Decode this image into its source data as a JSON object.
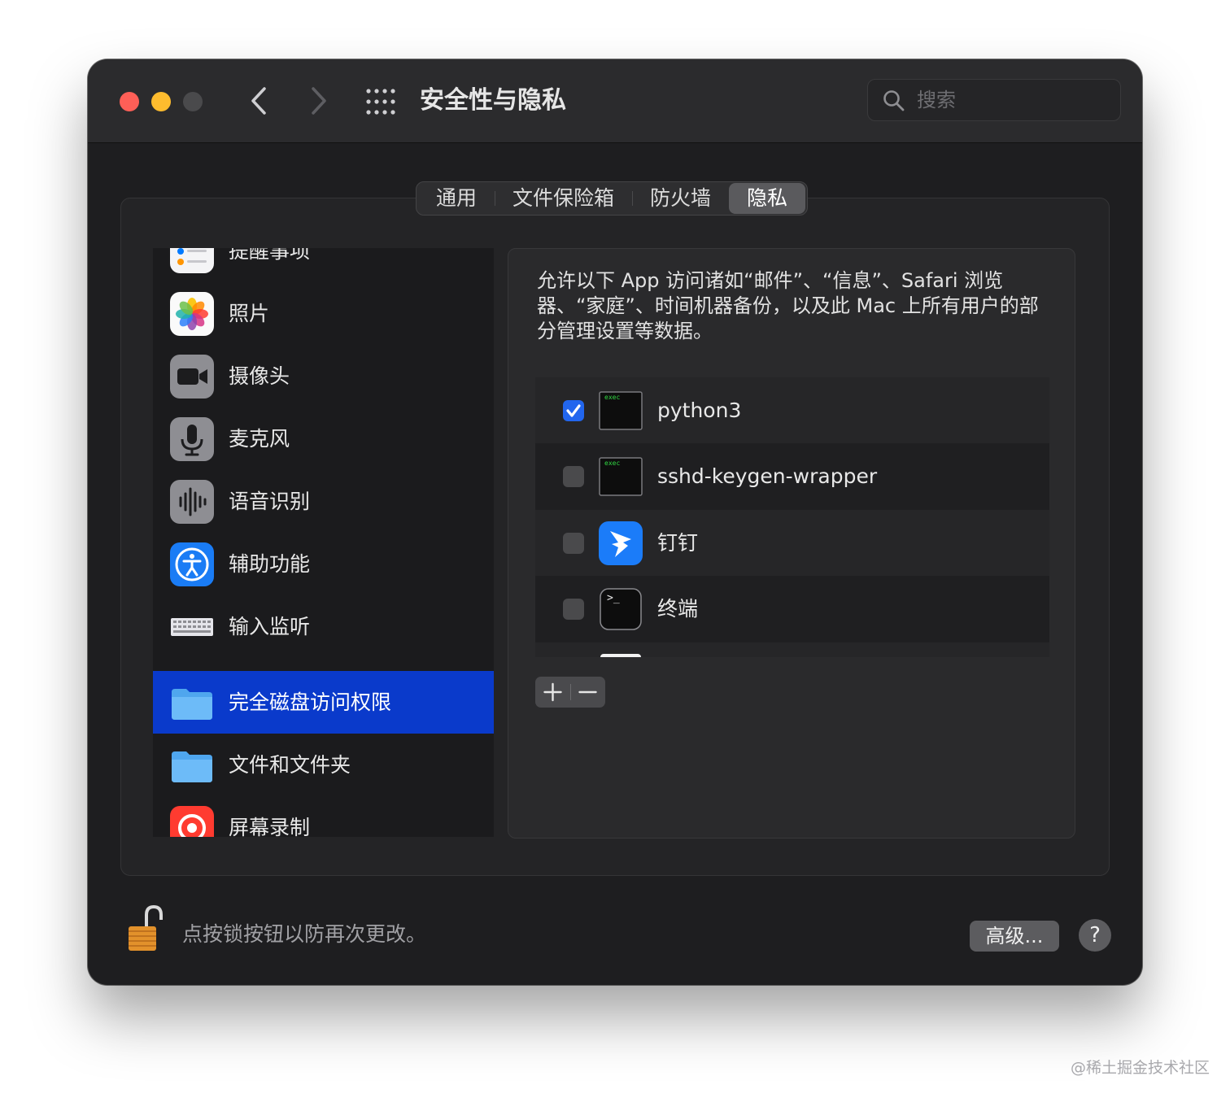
{
  "window": {
    "title": "安全性与隐私",
    "search_placeholder": "搜索"
  },
  "tabs": [
    {
      "label": "通用",
      "active": false
    },
    {
      "label": "文件保险箱",
      "active": false
    },
    {
      "label": "防火墙",
      "active": false
    },
    {
      "label": "隐私",
      "active": true
    }
  ],
  "sidebar": {
    "items": [
      {
        "label": "提醒事项",
        "icon": "reminders-icon"
      },
      {
        "label": "照片",
        "icon": "photos-icon"
      },
      {
        "label": "摄像头",
        "icon": "camera-icon"
      },
      {
        "label": "麦克风",
        "icon": "microphone-icon"
      },
      {
        "label": "语音识别",
        "icon": "speech-recognition-icon"
      },
      {
        "label": "辅助功能",
        "icon": "accessibility-icon"
      },
      {
        "label": "输入监听",
        "icon": "keyboard-icon"
      },
      {
        "label": "完全磁盘访问权限",
        "icon": "folder-icon",
        "selected": true
      },
      {
        "label": "文件和文件夹",
        "icon": "folder-icon"
      },
      {
        "label": "屏幕录制",
        "icon": "screen-recording-icon"
      }
    ]
  },
  "panel": {
    "description": "允许以下 App 访问诸如“邮件”、“信息”、Safari 浏览器、“家庭”、时间机器备份，以及此 Mac 上所有用户的部分管理设置等数据。",
    "apps": [
      {
        "name": "python3",
        "checked": true,
        "icon": "exec-icon",
        "icon_text": "exec"
      },
      {
        "name": "sshd-keygen-wrapper",
        "checked": false,
        "icon": "exec-icon",
        "icon_text": "exec"
      },
      {
        "name": "钉钉",
        "checked": false,
        "icon": "dingtalk-icon"
      },
      {
        "name": "终端",
        "checked": false,
        "icon": "terminal-icon",
        "icon_text": ">_"
      }
    ],
    "add_label": "+",
    "remove_label": "−"
  },
  "footer": {
    "lock_text": "点按锁按钮以防再次更改。",
    "advanced_label": "高级...",
    "help_label": "?"
  },
  "watermark": "@稀土掘金技术社区",
  "colors": {
    "window_bg": "#1e1e20",
    "selection": "#0a3acb",
    "checkbox_on": "#2266ee",
    "close": "#fe5f57",
    "minimize": "#febc2e"
  }
}
